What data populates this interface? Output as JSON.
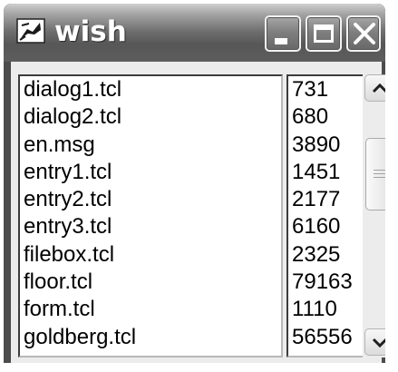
{
  "window": {
    "title": "wish",
    "icon": "feather-pen-icon"
  },
  "titlebar_buttons": [
    "minimize-icon",
    "maximize-icon",
    "close-icon"
  ],
  "files": [
    {
      "name": "dialog1.tcl",
      "size": "731"
    },
    {
      "name": "dialog2.tcl",
      "size": "680"
    },
    {
      "name": "en.msg",
      "size": "3890"
    },
    {
      "name": "entry1.tcl",
      "size": "1451"
    },
    {
      "name": "entry2.tcl",
      "size": "2177"
    },
    {
      "name": "entry3.tcl",
      "size": "6160"
    },
    {
      "name": "filebox.tcl",
      "size": "2325"
    },
    {
      "name": "floor.tcl",
      "size": "79163"
    },
    {
      "name": "form.tcl",
      "size": "1110"
    },
    {
      "name": "goldberg.tcl",
      "size": "56556"
    }
  ],
  "scrollbar": {
    "up_icon": "chevron-up-icon",
    "down_icon": "chevron-down-icon",
    "thumb_icon": "grip-icon"
  }
}
